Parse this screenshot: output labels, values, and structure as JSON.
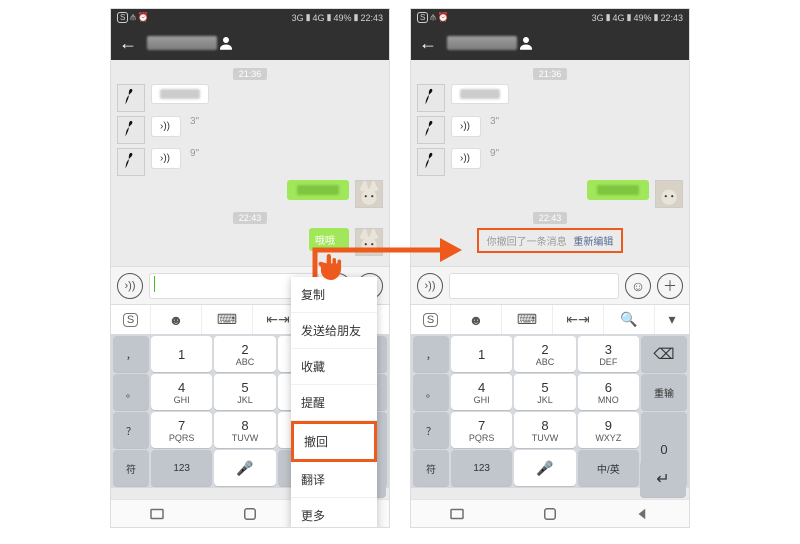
{
  "status": {
    "battery": "49%",
    "time": "22:43",
    "net1": "3G",
    "net2": "4G"
  },
  "timestamps": {
    "t1": "21:36",
    "t2": "22:43"
  },
  "voice": {
    "d1": "3\"",
    "d2": "9\""
  },
  "selected_bubble": "哦哦",
  "ctx": {
    "copy": "复制",
    "forward": "发送给朋友",
    "favorite": "收藏",
    "remind": "提醒",
    "recall": "撤回",
    "translate": "翻译",
    "more": "更多"
  },
  "recall": {
    "text": "你撤回了一条消息",
    "link": "重新编辑"
  },
  "keys": {
    "row_sym": [
      "，",
      "。",
      "？",
      "！"
    ],
    "backspace": "⌫",
    "reinput": "重输",
    "zero": "0",
    "space_left": "符",
    "num_toggle": "123",
    "cn_en": "中/英",
    "enter": "↵",
    "k1": {
      "n": "1",
      "l": ""
    },
    "k2": {
      "n": "2",
      "l": "ABC"
    },
    "k3": {
      "n": "3",
      "l": "DEF"
    },
    "k4": {
      "n": "4",
      "l": "GHI"
    },
    "k5": {
      "n": "5",
      "l": "JKL"
    },
    "k6": {
      "n": "6",
      "l": "MNO"
    },
    "k7": {
      "n": "7",
      "l": "PQRS"
    },
    "k8": {
      "n": "8",
      "l": "TUVW"
    },
    "k9": {
      "n": "9",
      "l": "WXYZ"
    }
  }
}
